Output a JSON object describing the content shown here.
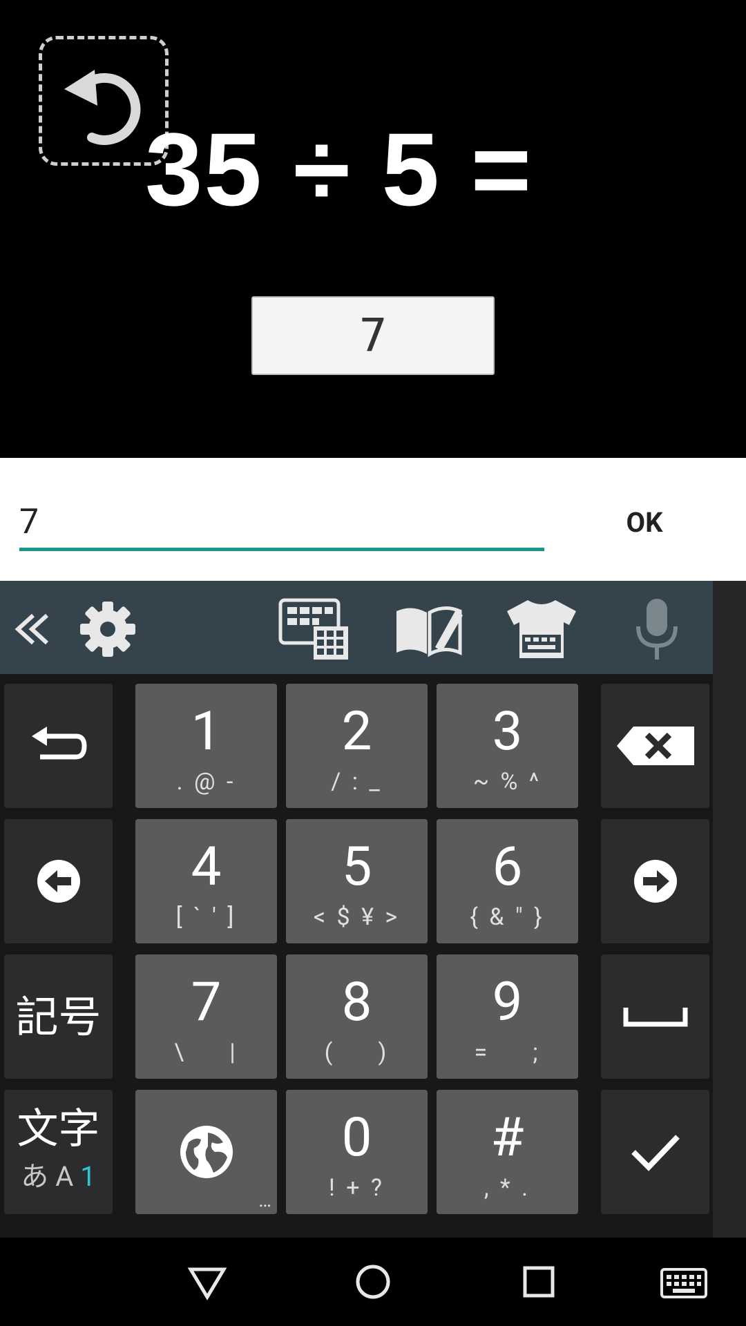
{
  "quiz": {
    "equation": "35 ÷ 5 =",
    "answer_display": "7"
  },
  "input": {
    "value": "7",
    "ok_label": "OK",
    "accent": "#1a9687"
  },
  "keyboard": {
    "keys": [
      {
        "main": "1",
        "sub": ". @ -"
      },
      {
        "main": "2",
        "sub": "/ : _"
      },
      {
        "main": "3",
        "sub": "~ % ^"
      },
      {
        "main": "4",
        "sub": "[ ` ' ]"
      },
      {
        "main": "5",
        "sub": "< $ ¥ >"
      },
      {
        "main": "6",
        "sub": "{ & \" }"
      },
      {
        "main": "7",
        "sub": "\\     |"
      },
      {
        "main": "8",
        "sub": "(     )"
      },
      {
        "main": "9",
        "sub": "=     ;"
      },
      {
        "main": "0",
        "sub": "! + ?"
      },
      {
        "main": "#",
        "sub": ", * ."
      }
    ],
    "symbol_key": "記号",
    "mode_key_top": "文字",
    "mode_key_bottom": "あ A ",
    "mode_key_active": "1",
    "globe_more": "…"
  }
}
